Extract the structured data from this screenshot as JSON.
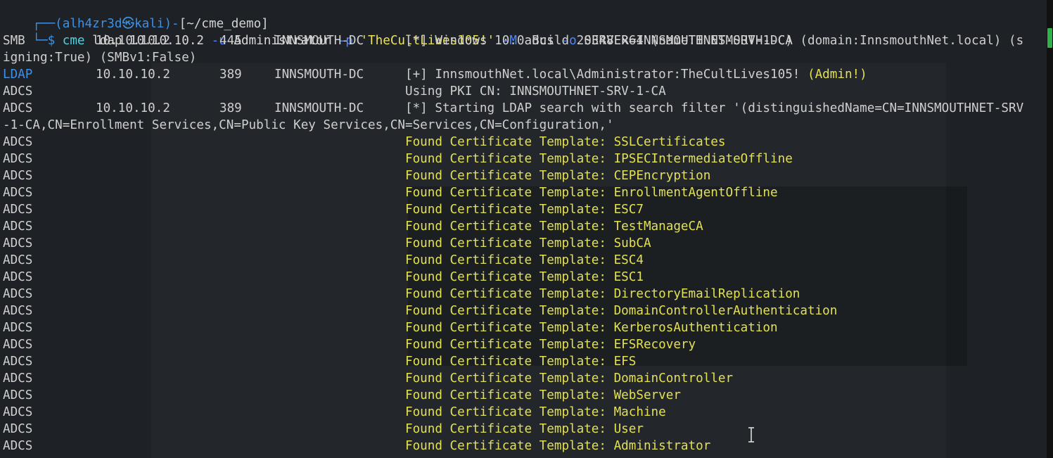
{
  "prompt": {
    "user_host": "(alh4zr3d㉿kali)",
    "path": "[~/cme_demo]",
    "dollar": "$"
  },
  "command": {
    "tool": "cme",
    "args1": " ldap 10.10.10.2 ",
    "flag_u": "-u",
    "user": " Administrator ",
    "flag_p": "-p",
    "password": " 'TheCultLives105!' ",
    "flag_M": "-M",
    "module": " adcs ",
    "flag_o": "-o",
    "option": " SERVER=INNSMOUTHNET-SRV-1-CA"
  },
  "output": [
    {
      "proto": "SMB",
      "ip": "10.10.10.2",
      "port": "445",
      "host": "INNSMOUTH-DC",
      "msg": "[*] Windows 10.0 Build 20348 x64 (name:INNSMOUTH-DC) (domain:InnsmouthNet.local) (s"
    },
    {
      "cont": "igning:True) (SMBv1:False)"
    },
    {
      "proto": "LDAP",
      "ip": "10.10.10.2",
      "port": "389",
      "host": "INNSMOUTH-DC",
      "msg": "[+] InnsmouthNet.local\\Administrator:TheCultLives105! ",
      "msg2": "(Admin!)"
    },
    {
      "proto": "ADCS",
      "msg": "Using PKI CN: INNSMOUTHNET-SRV-1-CA"
    },
    {
      "proto": "ADCS",
      "ip": "10.10.10.2",
      "port": "389",
      "host": "INNSMOUTH-DC",
      "msg": "[*] Starting LDAP search with search filter '(distinguishedName=CN=INNSMOUTHNET-SRV"
    },
    {
      "cont": "-1-CA,CN=Enrollment Services,CN=Public Key Services,CN=Services,CN=Configuration,'"
    }
  ],
  "templates_prefix": "Found Certificate Template: ",
  "templates_proto": "ADCS",
  "templates": [
    "SSLCertificates",
    "IPSECIntermediateOffline",
    "CEPEncryption",
    "EnrollmentAgentOffline",
    "ESC7",
    "TestManageCA",
    "SubCA",
    "ESC4",
    "ESC1",
    "DirectoryEmailReplication",
    "DomainControllerAuthentication",
    "KerberosAuthentication",
    "EFSRecovery",
    "EFS",
    "DomainController",
    "WebServer",
    "Machine",
    "User",
    "Administrator"
  ],
  "colors": {
    "background": "#1e2125",
    "prompt": "#3c91e6",
    "command": "#54d0df",
    "string": "#e8e35a",
    "template_text": "#e2e054",
    "scroll_thumb": "#2db34a"
  }
}
